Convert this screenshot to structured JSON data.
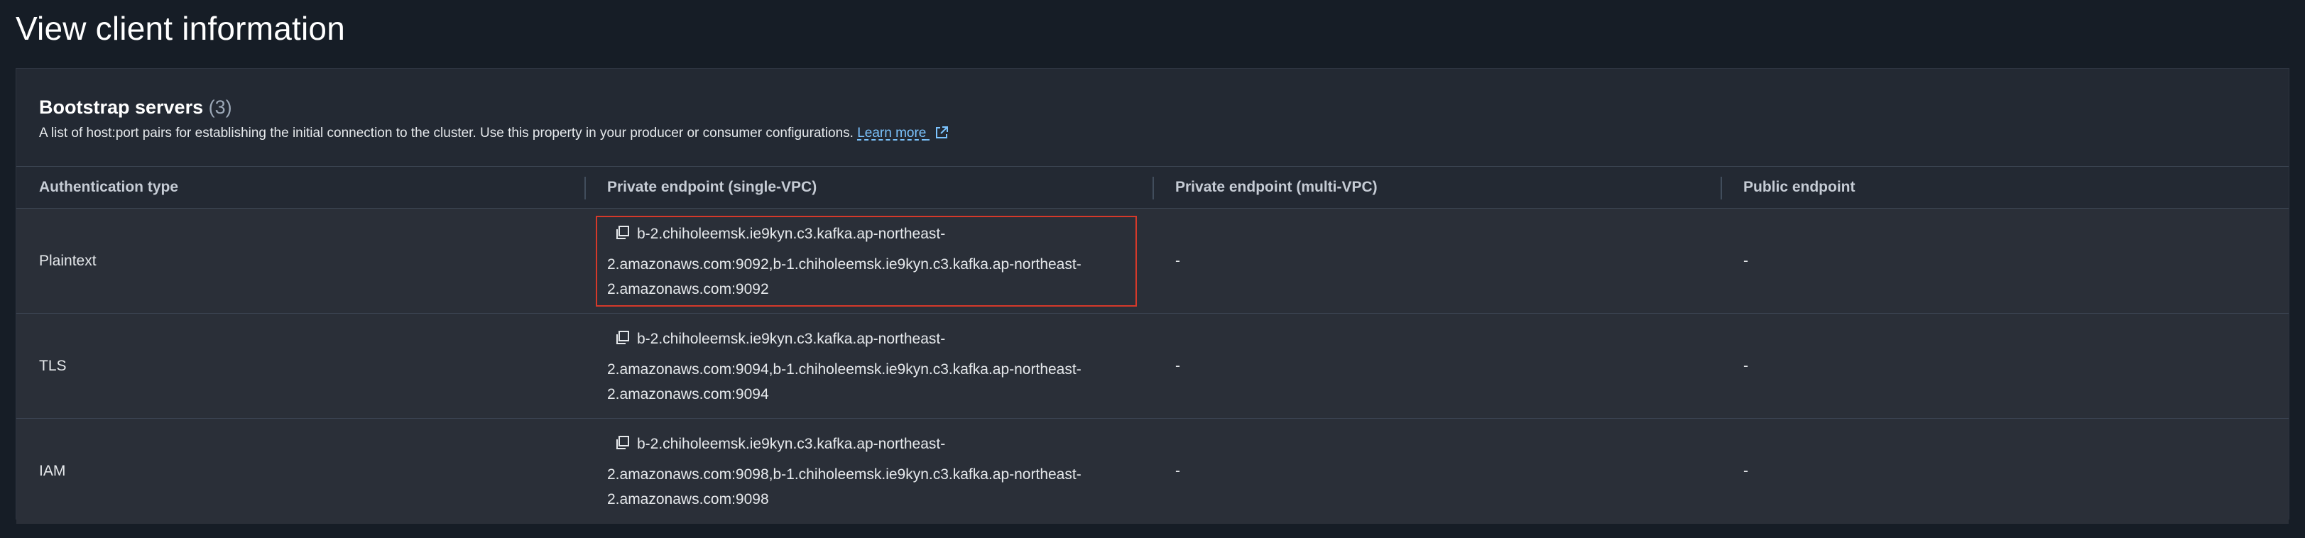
{
  "page": {
    "title": "View client information"
  },
  "bootstrap": {
    "title": "Bootstrap servers",
    "count": "(3)",
    "description": "A list of host:port pairs for establishing the initial connection to the cluster. Use this property in your producer or consumer configurations.",
    "learn_more": "Learn more",
    "learn_more_icon": "external-link-icon"
  },
  "table": {
    "columns": [
      "Authentication type",
      "Private endpoint (single-VPC)",
      "Private endpoint (multi-VPC)",
      "Public endpoint"
    ],
    "rows": [
      {
        "auth": "Plaintext",
        "single_vpc_line1": "b-2.chiholeemsk.ie9kyn.c3.kafka.ap-northeast-",
        "single_vpc_line2": "2.amazonaws.com:9092,b-1.chiholeemsk.ie9kyn.c3.kafka.ap-northeast-",
        "single_vpc_line3": "2.amazonaws.com:9092",
        "multi_vpc": "-",
        "public": "-"
      },
      {
        "auth": "TLS",
        "single_vpc_line1": "b-2.chiholeemsk.ie9kyn.c3.kafka.ap-northeast-",
        "single_vpc_line2": "2.amazonaws.com:9094,b-1.chiholeemsk.ie9kyn.c3.kafka.ap-northeast-",
        "single_vpc_line3": "2.amazonaws.com:9094",
        "multi_vpc": "-",
        "public": "-"
      },
      {
        "auth": "IAM",
        "single_vpc_line1": "b-2.chiholeemsk.ie9kyn.c3.kafka.ap-northeast-",
        "single_vpc_line2": "2.amazonaws.com:9098,b-1.chiholeemsk.ie9kyn.c3.kafka.ap-northeast-",
        "single_vpc_line3": "2.amazonaws.com:9098",
        "multi_vpc": "-",
        "public": "-"
      }
    ],
    "copy_icon": "copy-icon",
    "highlight_color": "#d5392a"
  },
  "colors": {
    "background": "#161d26",
    "panel": "#232933",
    "row": "#2a2f38",
    "link": "#7cc4ff"
  }
}
